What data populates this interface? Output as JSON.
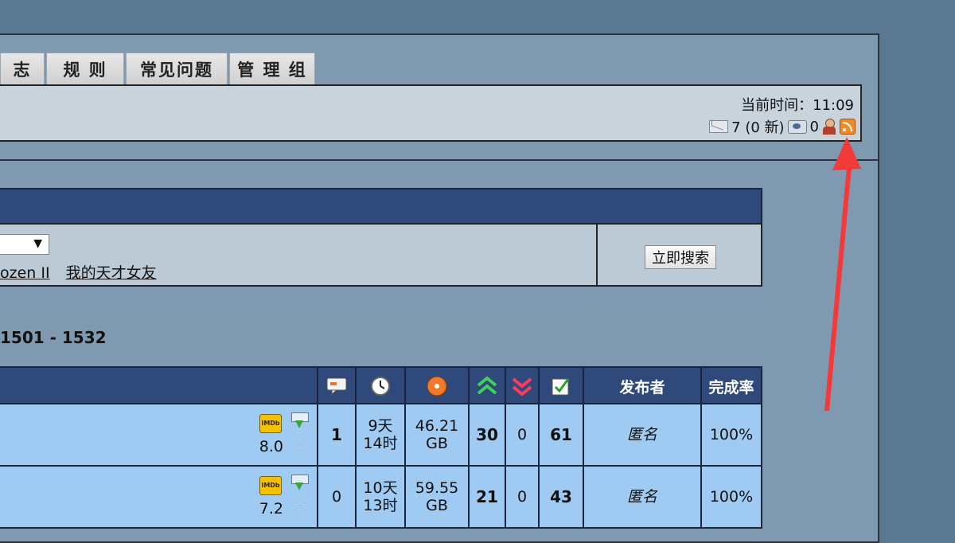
{
  "tabs": [
    {
      "label": "志"
    },
    {
      "label": "规 则"
    },
    {
      "label": "常见问题"
    },
    {
      "label": "管 理 组"
    }
  ],
  "infobar": {
    "time_label": "当前时间：11:09",
    "messages": "7 (0 新)",
    "viewers": "0"
  },
  "search": {
    "dropdown_arrow": "▼",
    "links": [
      "ozen II",
      "我的天才女友"
    ],
    "button_label": "立即搜索"
  },
  "page_range": "1501 - 1532",
  "table": {
    "headers": {
      "comments_icon": "comment-icon",
      "time_icon": "clock-icon",
      "size_icon": "disc-icon",
      "seeders_icon": "up-arrows-icon",
      "leechers_icon": "down-arrows-icon",
      "completed_icon": "check-icon",
      "uploader": "发布者",
      "completion": "完成率"
    },
    "rows": [
      {
        "rating": "8.0",
        "badge": "IMDb",
        "comments": "1",
        "time1": "9天",
        "time2": "14时",
        "size1": "46.21",
        "size2": "GB",
        "seeders": "30",
        "leechers": "0",
        "completed": "61",
        "uploader": "匿名",
        "completion": "100%"
      },
      {
        "rating": "7.2",
        "badge": "IMDb",
        "comments": "0",
        "time1": "10天",
        "time2": "13时",
        "size1": "59.55",
        "size2": "GB",
        "seeders": "21",
        "leechers": "0",
        "completed": "43",
        "uploader": "匿名",
        "completion": "100%"
      }
    ]
  },
  "colors": {
    "annotation_arrow": "#f23a3a",
    "header_blue": "#2f4a7a",
    "row_blue": "#9fcaf2"
  }
}
